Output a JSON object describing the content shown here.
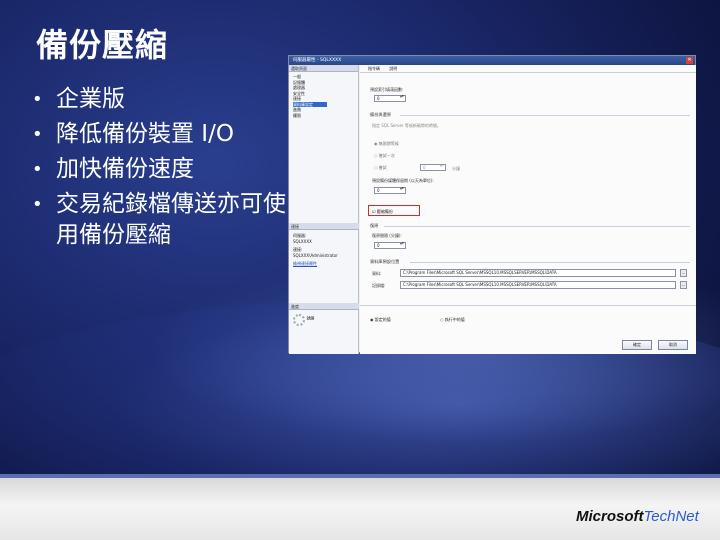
{
  "slide": {
    "title": "備份壓縮",
    "bullets": [
      "企業版",
      "降低備份裝置 I/O",
      "加快備份速度",
      "交易紀錄檔傳送亦可使用備份壓縮"
    ],
    "logo_brand": "Microsoft",
    "logo_product": "TechNet"
  },
  "dialog": {
    "title": "伺服器屬性 - SQLXXXX",
    "close_glyph": "✕",
    "left": {
      "header": "選取頁面",
      "pages": [
        "一般",
        "記憶體",
        "處理器",
        "安全性",
        "連接",
        "資料庫設定",
        "進階",
        "權限"
      ],
      "selected_index": 5,
      "connection_header": "連接",
      "server_label": "伺服器:",
      "server_value": "SQLXXXX",
      "connection_label": "連接:",
      "connection_value": "SQLXXX\\Administrator",
      "view_link": "檢視連接屬性",
      "progress_header": "進度",
      "progress_status": "就緒"
    },
    "toolbar": {
      "script": "指令碼",
      "help": "說明"
    },
    "fields": {
      "default_fill_factor_label": "預設索引填滿因數:",
      "fill_factor_value": "0",
      "backup_restore_section": "備份與還原",
      "tape_note": "指定 SQL Server 等候新磁帶的時間。",
      "wait_indefinitely": "無限期等候",
      "try_once": "嘗試一次",
      "try_for": "嘗試",
      "minutes": "分鐘",
      "minutes_value": "0",
      "retention_label": "預設備份媒體保留期 (以天為單位):",
      "retention_value": "0",
      "compress_backup": "壓縮備份",
      "recovery_section": "復原",
      "recovery_interval_label": "復原間隔 (分鐘):",
      "recovery_value": "0",
      "db_default_locations_section": "資料庫預設位置",
      "data_label": "資料:",
      "data_path": "C:\\Program Files\\Microsoft SQL Server\\MSSQL10.MSSQLSERVER\\MSSQL\\DATA",
      "log_label": "記錄檔:",
      "log_path": "C:\\Program Files\\Microsoft SQL Server\\MSSQL10.MSSQLSERVER\\MSSQL\\DATA",
      "browse": "...",
      "configured_values": "設定的值",
      "running_values": "執行中的值"
    },
    "buttons": {
      "ok": "確定",
      "cancel": "取消"
    }
  }
}
